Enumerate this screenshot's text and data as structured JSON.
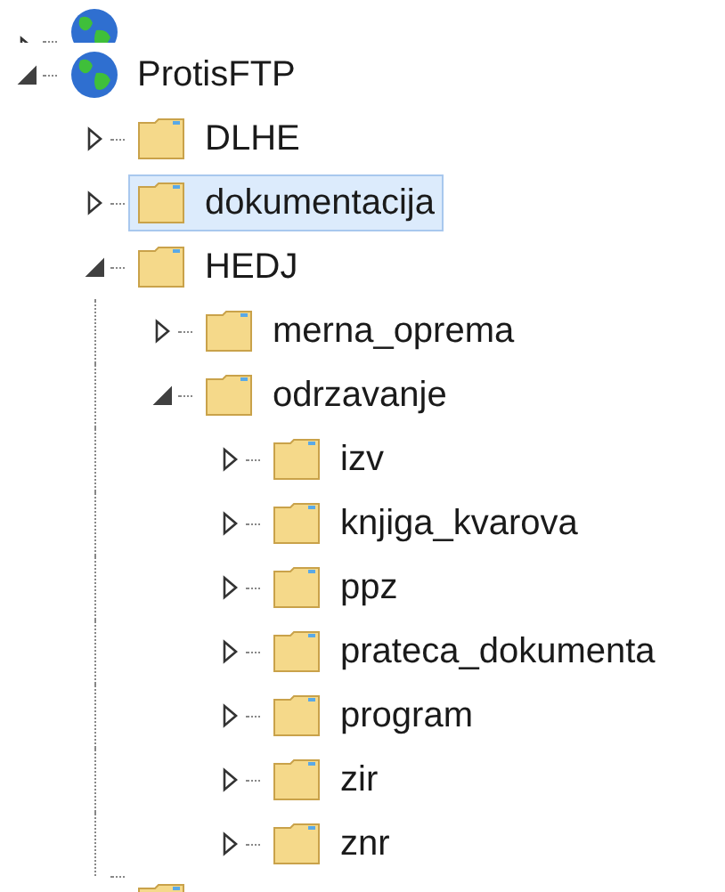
{
  "tree": [
    {
      "kind": "site",
      "clipped": true,
      "expanded": false
    },
    {
      "kind": "site",
      "label": "ProtisFTP",
      "expanded": true,
      "selected": false,
      "children": [
        {
          "kind": "folder",
          "label": "DLHE",
          "expanded": false,
          "selected": false
        },
        {
          "kind": "folder",
          "label": "dokumentacija",
          "expanded": false,
          "selected": true
        },
        {
          "kind": "folder",
          "label": "HEDJ",
          "expanded": true,
          "selected": false,
          "children": [
            {
              "kind": "folder",
              "label": "merna_oprema",
              "expanded": false,
              "selected": false
            },
            {
              "kind": "folder",
              "label": "odrzavanje",
              "expanded": true,
              "selected": false,
              "children": [
                {
                  "kind": "folder",
                  "label": "izv",
                  "expanded": false,
                  "selected": false
                },
                {
                  "kind": "folder",
                  "label": "knjiga_kvarova",
                  "expanded": false,
                  "selected": false
                },
                {
                  "kind": "folder",
                  "label": "ppz",
                  "expanded": false,
                  "selected": false
                },
                {
                  "kind": "folder",
                  "label": "prateca_dokumenta",
                  "expanded": false,
                  "selected": false
                },
                {
                  "kind": "folder",
                  "label": "program",
                  "expanded": false,
                  "selected": false
                },
                {
                  "kind": "folder",
                  "label": "zir",
                  "expanded": false,
                  "selected": false
                },
                {
                  "kind": "folder",
                  "label": "znr",
                  "expanded": false,
                  "selected": false
                }
              ]
            }
          ]
        },
        {
          "kind": "folder",
          "clipped": true
        }
      ]
    }
  ]
}
